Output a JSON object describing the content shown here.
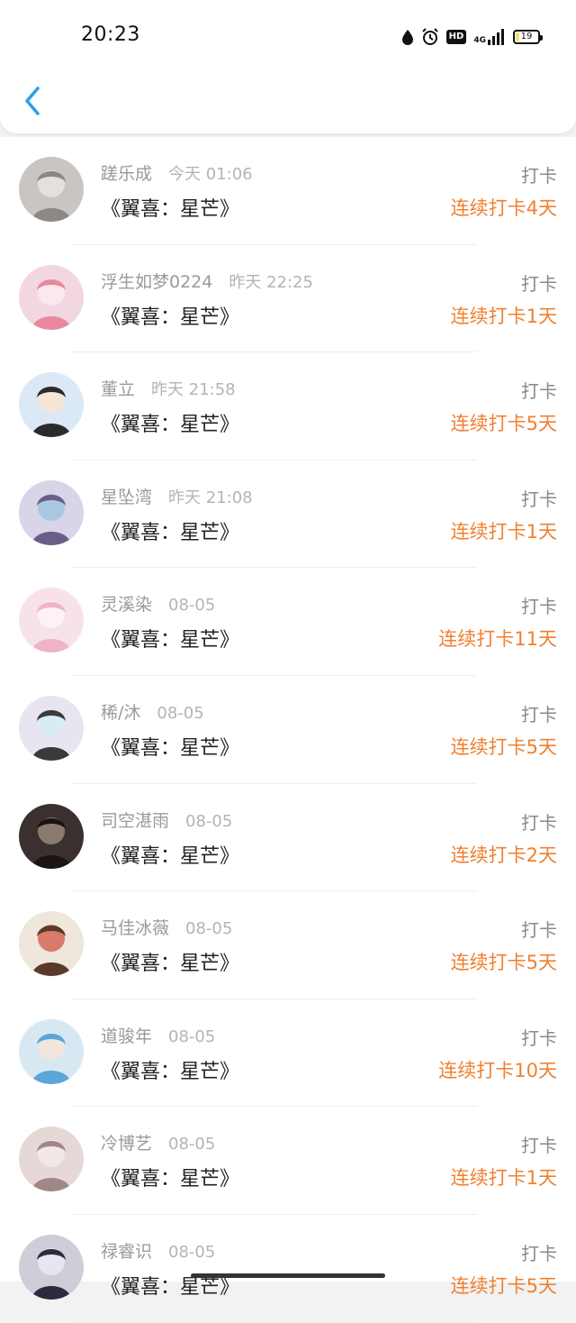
{
  "status_bar": {
    "time": "20:23",
    "network": "4G",
    "hd": "HD",
    "battery": "19",
    "battery_level": 0.19
  },
  "header": {
    "back_icon": "chevron-left-icon",
    "accent_color": "#2a9fe6"
  },
  "colors": {
    "streak": "#f08030",
    "name": "#9a9a9a",
    "title": "#222222"
  },
  "entries": [
    {
      "name": "蹉乐成",
      "time": "今天 01:06",
      "book": "《翼喜：星芒》",
      "action": "打卡",
      "streak": "连续打卡4天"
    },
    {
      "name": "浮生如梦0224",
      "time": "昨天 22:25",
      "book": "《翼喜：星芒》",
      "action": "打卡",
      "streak": "连续打卡1天"
    },
    {
      "name": "董立",
      "time": "昨天 21:58",
      "book": "《翼喜：星芒》",
      "action": "打卡",
      "streak": "连续打卡5天"
    },
    {
      "name": "星坠湾",
      "time": "昨天 21:08",
      "book": "《翼喜：星芒》",
      "action": "打卡",
      "streak": "连续打卡1天"
    },
    {
      "name": "灵溪染",
      "time": "08-05",
      "book": "《翼喜：星芒》",
      "action": "打卡",
      "streak": "连续打卡11天"
    },
    {
      "name": "稀/沐",
      "time": "08-05",
      "book": "《翼喜：星芒》",
      "action": "打卡",
      "streak": "连续打卡5天"
    },
    {
      "name": "司空湛雨",
      "time": "08-05",
      "book": "《翼喜：星芒》",
      "action": "打卡",
      "streak": "连续打卡2天"
    },
    {
      "name": "马佳冰薇",
      "time": "08-05",
      "book": "《翼喜：星芒》",
      "action": "打卡",
      "streak": "连续打卡5天"
    },
    {
      "name": "道骏年",
      "time": "08-05",
      "book": "《翼喜：星芒》",
      "action": "打卡",
      "streak": "连续打卡10天"
    },
    {
      "name": "冷博艺",
      "time": "08-05",
      "book": "《翼喜：星芒》",
      "action": "打卡",
      "streak": "连续打卡1天"
    },
    {
      "name": "禄睿识",
      "time": "08-05",
      "book": "《翼喜：星芒》",
      "action": "打卡",
      "streak": "连续打卡5天"
    }
  ]
}
